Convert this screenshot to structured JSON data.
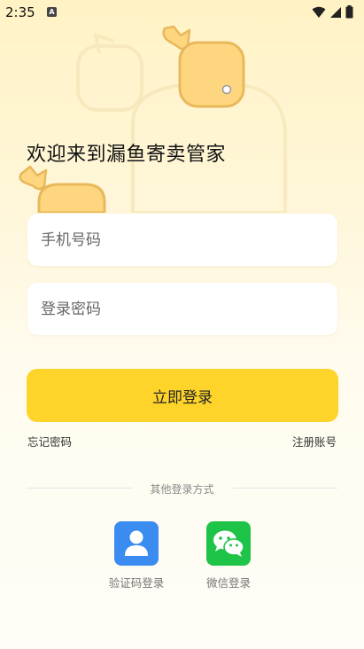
{
  "status_bar": {
    "time": "2:35",
    "badge": "A"
  },
  "welcome_title": "欢迎来到漏鱼寄卖管家",
  "phone_input": {
    "placeholder": "手机号码",
    "value": ""
  },
  "password_input": {
    "placeholder": "登录密码",
    "value": ""
  },
  "login_button": "立即登录",
  "forgot_password": "忘记密码",
  "register_account": "注册账号",
  "other_methods_label": "其他登录方式",
  "methods": [
    {
      "label": "验证码登录",
      "icon": "user-icon",
      "color": "#3b8cf0"
    },
    {
      "label": "微信登录",
      "icon": "wechat-icon",
      "color": "#1ec447"
    }
  ],
  "colors": {
    "accent": "#ffd42a",
    "background": "#fff6d8"
  }
}
